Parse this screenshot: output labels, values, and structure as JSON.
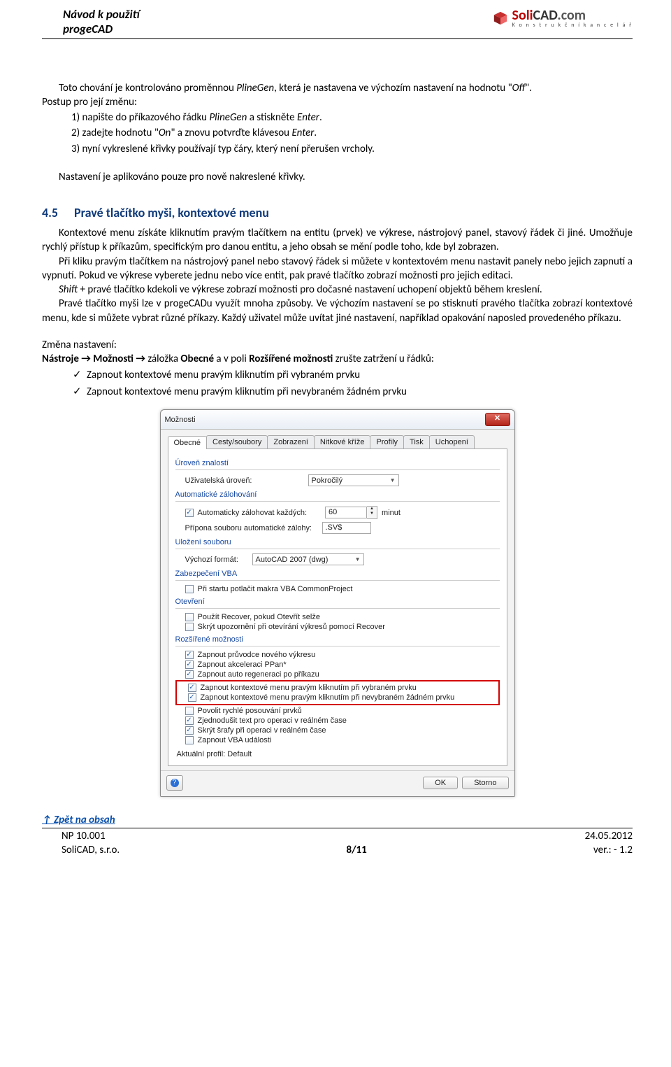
{
  "header": {
    "line1": "Návod k použití",
    "line2": "progeCAD",
    "logo_main_soli": "Soli",
    "logo_main_cad": "CAD",
    "logo_main_com": ".com",
    "logo_sub": "K o n s t r u k č n í  k a n c e l á ř"
  },
  "p1a": "Toto chování je kontrolováno proměnnou ",
  "p1b": "PlineGen",
  "p1c": ", která je nastavena ve výchozím nastavení na hodnotu \"",
  "p1d": "Off",
  "p1e": "\".",
  "p2": "Postup pro její změnu:",
  "steps": {
    "s1a": "1)  napište do příkazového řádku ",
    "s1b": "PlineGen",
    "s1c": " a stiskněte ",
    "s1d": "Enter",
    "s1e": ".",
    "s2a": "2)  zadejte hodnotu \"",
    "s2b": "On",
    "s2c": "\" a znovu potvrďte klávesou ",
    "s2d": "Enter",
    "s2e": ".",
    "s3": "3)  nyní vykreslené křivky používají typ čáry, který není přerušen vrcholy."
  },
  "p3": "Nastavení je aplikováno pouze pro nově nakreslené křivky.",
  "section": {
    "num": "4.5",
    "title": "Pravé tlačítko myši, kontextové menu"
  },
  "p4": "Kontextové menu získáte kliknutím pravým tlačítkem na entitu (prvek) ve výkrese, nástrojový panel, stavový řádek či jiné. Umožňuje rychlý přístup k příkazům, specifickým pro danou entitu, a jeho obsah se mění podle toho, kde byl zobrazen.",
  "p5": "Při kliku pravým tlačítkem na nástrojový panel nebo stavový řádek si můžete v kontextovém menu nastavit panely nebo jejich zapnutí a vypnutí. Pokud ve výkrese vyberete jednu nebo více entit, pak pravé tlačítko zobrazí možnosti pro jejich editaci.",
  "p6a": "Shift",
  "p6b": " + pravé tlačítko kdekoli ve výkrese zobrazí možnosti pro dočasné nastavení uchopení objektů během kreslení.",
  "p7": "Pravé tlačítko myši lze v progeCADu využít mnoha způsoby. Ve výchozím nastavení se po stisknutí pravého tlačítka zobrazí kontextové menu, kde si můžete vybrat různé příkazy. Každý uživatel může uvítat jiné nastavení, například opakování naposled provedeného příkazu.",
  "change": "Změna nastavení:",
  "navline_a": "Nástroje → Možnosti → ",
  "navline_b": "záložka ",
  "navline_c": "Obecné",
  "navline_d": " a v poli ",
  "navline_e": "Rozšířené možnosti",
  "navline_f": " zrušte zatržení u řádků:",
  "chk1": "Zapnout kontextové menu pravým kliknutím při vybraném prvku",
  "chk2": "Zapnout kontextové menu pravým kliknutím při nevybraném žádném prvku",
  "dialog": {
    "title": "Možnosti",
    "tabs": [
      "Obecné",
      "Cesty/soubory",
      "Zobrazení",
      "Nitkové kříže",
      "Profily",
      "Tisk",
      "Uchopení"
    ],
    "grp_skill": "Úroveň znalostí",
    "skill_label": "Uživatelská úroveň:",
    "skill_value": "Pokročilý",
    "grp_backup": "Automatické zálohování",
    "backup_cb": "Automaticky zálohovat každých:",
    "backup_val": "60",
    "backup_unit": "minut",
    "backup_ext_label": "Přípona souboru automatické zálohy:",
    "backup_ext_val": ".SV$",
    "grp_save": "Uložení souboru",
    "save_label": "Výchozí formát:",
    "save_value": "AutoCAD 2007 (dwg)",
    "grp_vba": "Zabezpečení VBA",
    "vba_cb": "Při startu potlačit makra VBA CommonProject",
    "grp_open": "Otevření",
    "open_cb1": "Použít Recover, pokud Otevřít selže",
    "open_cb2": "Skrýt upozornění při otevírání výkresů pomocí Recover",
    "grp_ext": "Rozšířené možnosti",
    "ext_cb1": "Zapnout průvodce nového výkresu",
    "ext_cb2": "Zapnout akceleraci PPan*",
    "ext_cb3": "Zapnout auto regeneraci po příkazu",
    "ext_cb4": "Zapnout kontextové menu pravým kliknutím při vybraném prvku",
    "ext_cb5": "Zapnout kontextové menu pravým kliknutím při nevybraném žádném prvku",
    "ext_cb6": "Povolit rychlé posouvání prvků",
    "ext_cb7": "Zjednodušit text pro operaci v reálném čase",
    "ext_cb8": "Skrýt šrafy při operaci v reálném čase",
    "ext_cb9": "Zapnout VBA události",
    "profile": "Aktuální profil: Default",
    "ok": "OK",
    "cancel": "Storno"
  },
  "back": "↑ Zpět na obsah",
  "footer": {
    "l1": "NP 10.001",
    "c1": "",
    "r1": "24.05.2012",
    "l2": "SoliCAD, s.r.o.",
    "c2": "8/11",
    "r2": "ver.: - 1.2"
  }
}
